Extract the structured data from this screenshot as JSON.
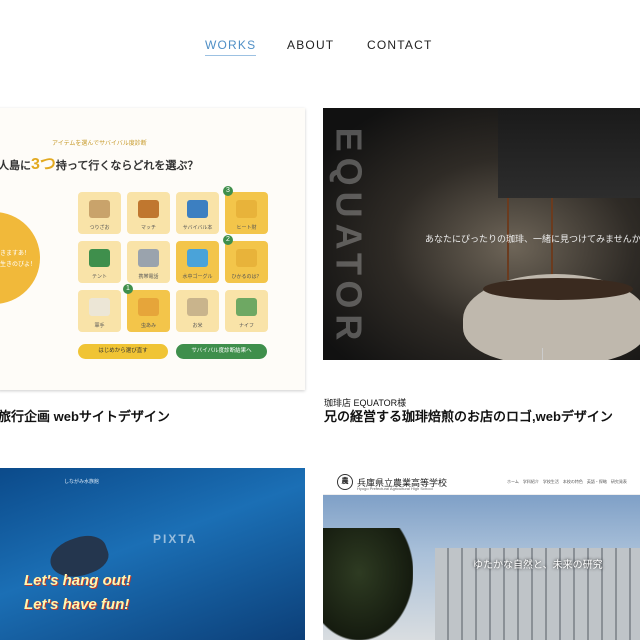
{
  "nav": {
    "works": "WORKS",
    "about": "ABOUT",
    "contact": "CONTACT"
  },
  "works": [
    {
      "title": "旅行企画 webサイトデザイン",
      "thumb": {
        "small_text": "アイテムを選んでサバイバル度診断",
        "question_pre": "人島に",
        "question_num": "3つ",
        "question_post": "持って行くならどれを選ぶ？",
        "blob_lines": [
          "きますあ！",
          "生きのびよ！"
        ],
        "items": [
          "つりざお",
          "マッチ",
          "サバイバル本",
          "ヒート財",
          "テント",
          "携帯電話",
          "水中ゴーグル",
          "ひかるのは？",
          "軍手",
          "虫あみ",
          "お米",
          "ナイフ"
        ],
        "badges": [
          "3",
          "2",
          "1"
        ],
        "reset_button": "はじめから選び直す",
        "result_button": "サバイバル度診断結果へ"
      }
    },
    {
      "subtitle": "珈琲店 EQUATOR様",
      "title": "兄の経営する珈琲焙煎のお店のロゴ,webデザイン",
      "thumb": {
        "vertical": "EQUATOR",
        "tagline": "あなたにぴったりの珈琲、一緒に見つけてみませんか"
      }
    },
    {
      "thumb": {
        "watermark": "PIXTA",
        "line1": "Let's hang out!",
        "line2": "Let's have fun!",
        "top_bar": "しながみ水族館"
      }
    },
    {
      "thumb": {
        "logo_char": "農",
        "school": "兵庫県立農業高等学校",
        "school_en": "Hyogo Prefectural Agricultural High School",
        "nav": "ホーム　学科紹介　学校生活　本校の特色　英語・探略　研究発表",
        "overlay": "ゆたかな自然と、未来の研究"
      }
    }
  ]
}
